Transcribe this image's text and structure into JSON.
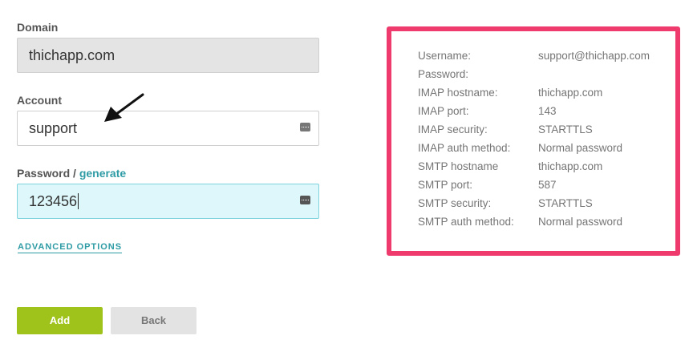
{
  "form": {
    "domain_label": "Domain",
    "domain_value": "thichapp.com",
    "account_label": "Account",
    "account_value": "support",
    "password_label": "Password /",
    "password_generate_link": "generate",
    "password_value": "123456",
    "advanced_options": "ADVANCED OPTIONS",
    "add_button": "Add",
    "back_button": "Back"
  },
  "info": {
    "rows": [
      {
        "key": "Username:",
        "value": "support@thichapp.com"
      },
      {
        "key": "Password:",
        "value": ""
      },
      {
        "key": "IMAP hostname:",
        "value": "thichapp.com"
      },
      {
        "key": "IMAP port:",
        "value": "143"
      },
      {
        "key": "IMAP security:",
        "value": "STARTTLS"
      },
      {
        "key": "IMAP auth method:",
        "value": "Normal password"
      },
      {
        "key": "SMTP hostname",
        "value": "thichapp.com"
      },
      {
        "key": "SMTP port:",
        "value": "587"
      },
      {
        "key": "SMTP security:",
        "value": "STARTTLS"
      },
      {
        "key": "SMTP auth method:",
        "value": "Normal password"
      }
    ]
  },
  "colors": {
    "accent_link": "#2e9ba5",
    "add_button": "#9fc31a",
    "highlight_border": "#ee3a6d",
    "focused_input_bg": "#ddf7fb"
  },
  "icons": [
    "keyboard-icon",
    "arrow-annotation-icon"
  ]
}
